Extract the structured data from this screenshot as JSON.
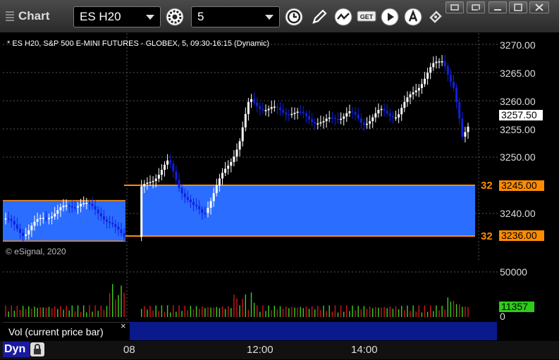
{
  "window": {
    "title": "Chart"
  },
  "toolbar": {
    "symbol": "ES H20",
    "interval": "5",
    "icons": [
      "settings-icon",
      "clock-icon",
      "pencil-icon",
      "chart-style-icon",
      "get-icon",
      "play-icon",
      "alert-icon",
      "pin-icon"
    ]
  },
  "chart": {
    "legend": "* ES H20, S&P 500 E-MINI FUTURES - GLOBEX, 5, 09:30-16:15 (Dynamic)",
    "copyright": "© eSignal, 2020",
    "price_ticks": [
      "3270.00",
      "3265.00",
      "3260.00",
      "3255.00",
      "3250.00",
      "3245.00",
      "3240.00",
      "3236.00"
    ],
    "last_price": "3257.50",
    "level_upper": "3245.00",
    "level_lower": "3236.00",
    "level_upper_count": "32",
    "level_lower_count": "32",
    "volume_ticks": [
      "50000",
      "0"
    ],
    "last_volume": "11357",
    "time_labels": [
      "08",
      "12:00",
      "14:00"
    ],
    "colors": {
      "zone": "#2a6dff",
      "level": "#ff8c00",
      "up": "#ffffff",
      "down": "#1020e0",
      "vol_up": "#3ecf1e",
      "vol_down": "#d01818"
    }
  },
  "study": {
    "label": "Vol (current price bar)",
    "close": "×"
  },
  "statusbar": {
    "mode": "Dyn"
  }
}
